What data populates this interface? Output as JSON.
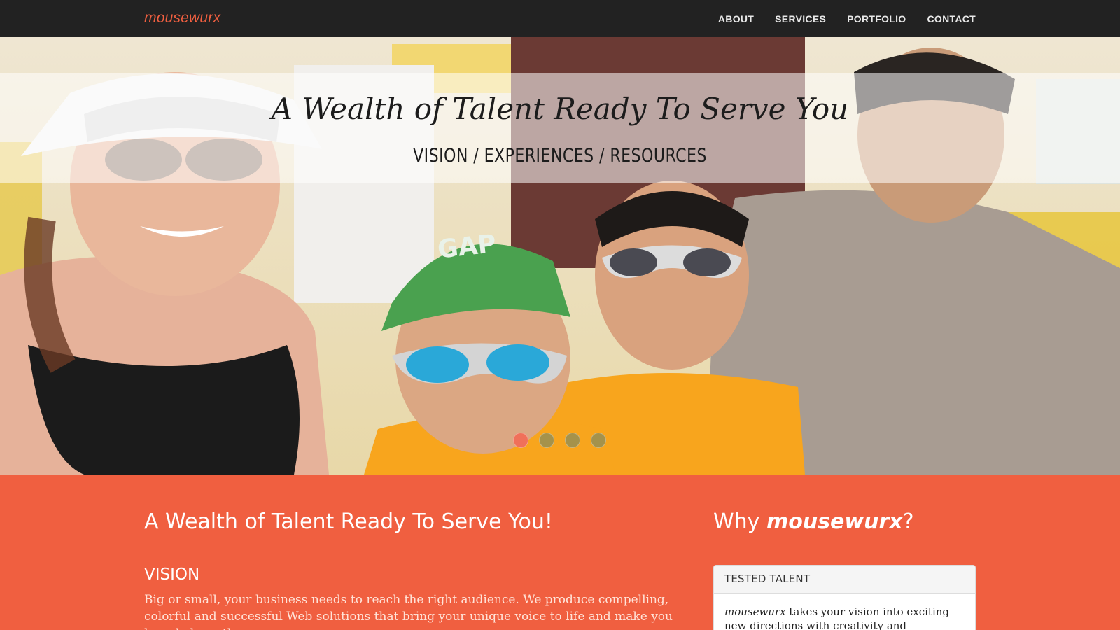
{
  "nav": {
    "brand": "mousewurx",
    "links": [
      "ABOUT",
      "SERVICES",
      "PORTFOLIO",
      "CONTACT"
    ]
  },
  "hero": {
    "title": "A Wealth of Talent Ready To Serve You",
    "subtitle": "VISION / EXPERIENCES / RESOURCES",
    "slides": {
      "count": 4,
      "active_index": 0
    }
  },
  "intro": {
    "heading": "A Wealth of Talent Ready To Serve You!",
    "vision_heading": "VISION",
    "vision_text": "Big or small, your business needs to reach the right audience. We produce compelling, colorful and successful Web solutions that bring your unique voice to life and make you heard above the"
  },
  "why": {
    "heading_prefix": "Why ",
    "heading_brand": "mousewurx",
    "heading_suffix": "?",
    "card_title": "TESTED TALENT",
    "card_brand": "mousewurx",
    "card_text": " takes your vision into exciting new directions with creativity and innovation –"
  },
  "colors": {
    "accent": "#f05f40",
    "navbar": "#222222",
    "dot_active": "#f0705a"
  }
}
